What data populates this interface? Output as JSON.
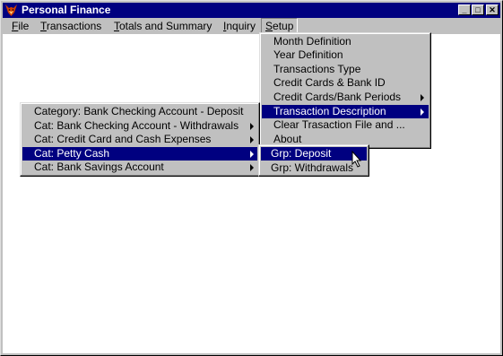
{
  "window": {
    "title": "Personal Finance",
    "minimize_label": "_",
    "maximize_label": "□",
    "close_label": "✕"
  },
  "menubar": {
    "items": [
      {
        "accel": "F",
        "rest": "ile"
      },
      {
        "accel": "T",
        "rest": "ransactions"
      },
      {
        "accel": "T",
        "rest": "otals and Summary"
      },
      {
        "accel": "I",
        "rest": "nquiry"
      },
      {
        "accel": "S",
        "rest": "etup"
      }
    ]
  },
  "setup_menu": {
    "items": [
      "Month Definition",
      "Year Definition",
      "Transactions Type",
      "Credit Cards & Bank ID",
      "Credit Cards/Bank Periods",
      "Transaction Description",
      "Clear Trasaction File and ...",
      "About"
    ]
  },
  "transaction_description_menu": {
    "items": [
      "Category: Bank Checking Account - Deposit",
      "Cat: Bank Checking Account - Withdrawals",
      "Cat: Credit Card and Cash Expenses",
      "Cat: Petty Cash",
      "Cat: Bank Savings Account"
    ]
  },
  "petty_cash_menu": {
    "items": [
      "Grp: Deposit",
      "Grp: Withdrawals"
    ]
  },
  "colors": {
    "titlebar": "#000080",
    "highlight": "#000080",
    "face": "#c0c0c0"
  },
  "icons": {
    "app": "fox-logo-icon",
    "cursor": "arrow-cursor-icon"
  }
}
